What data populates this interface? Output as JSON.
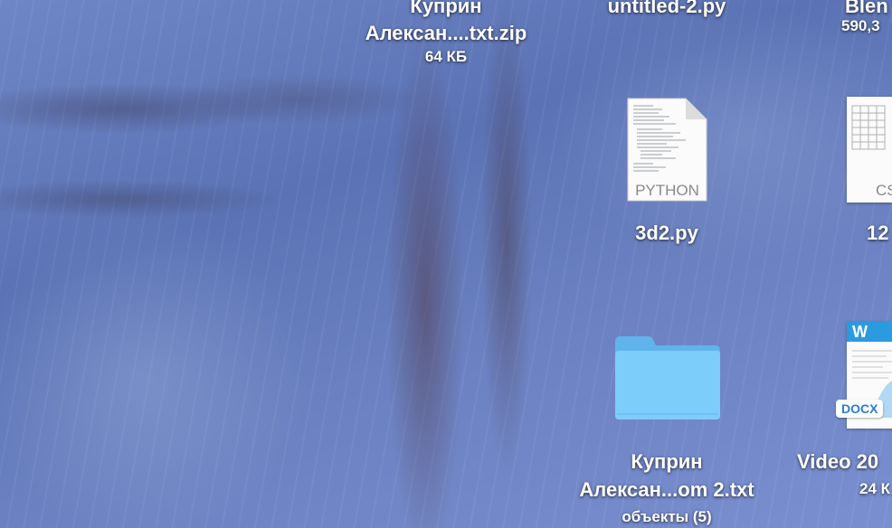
{
  "desktop": {
    "items": [
      {
        "name_line1": "Куприн",
        "name_line2": "Алексан....txt.zip",
        "meta": "64 КБ"
      },
      {
        "name_line1": "untitled-2.py"
      },
      {
        "name_line1": "Blen",
        "meta": "590,3"
      },
      {
        "name_line1": "3d2.py",
        "type_text": "PYTHON"
      },
      {
        "name_line1": "12",
        "type_text": "CS"
      },
      {
        "name_line1": "Куприн",
        "name_line2": "Алексан...om 2.txt",
        "meta": "объекты (5)"
      },
      {
        "name_line1": "Video 20",
        "meta": "24 К",
        "badge": "DOCX",
        "app_letter": "W"
      }
    ],
    "icons": [
      "zip-file-icon",
      "python-file-icon",
      "csv-file-icon",
      "folder-icon",
      "docx-file-icon"
    ],
    "accent_colors": {
      "folder": "#6ec3f4",
      "word_blue": "#2b7cd3",
      "wallpaper": "#6f86c6"
    }
  }
}
